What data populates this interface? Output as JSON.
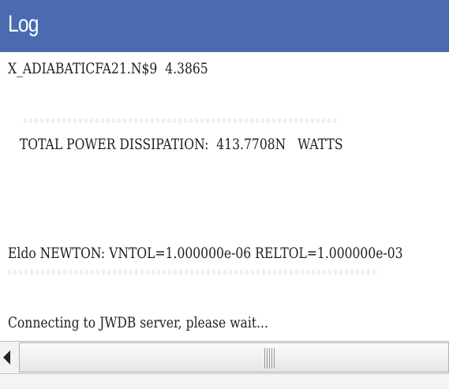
{
  "window": {
    "title": "Log"
  },
  "log": {
    "lines": [
      "X_ADIABATICFA21.N$9  4.3865",
      "   TOTAL POWER DISSIPATION:  413.7708N   WATTS",
      "Eldo NEWTON: VNTOL=1.000000e-06 RELTOL=1.000000e-03",
      "Connecting to JWDB server, please wait..."
    ]
  },
  "colors": {
    "title_bar": "#4a6bb0",
    "title_text": "#ffffff",
    "log_background": "#ffffff",
    "log_text": "#222222"
  },
  "icons": {
    "scroll_left": "triangle-left-icon",
    "scroll_grip": "grip-icon"
  }
}
